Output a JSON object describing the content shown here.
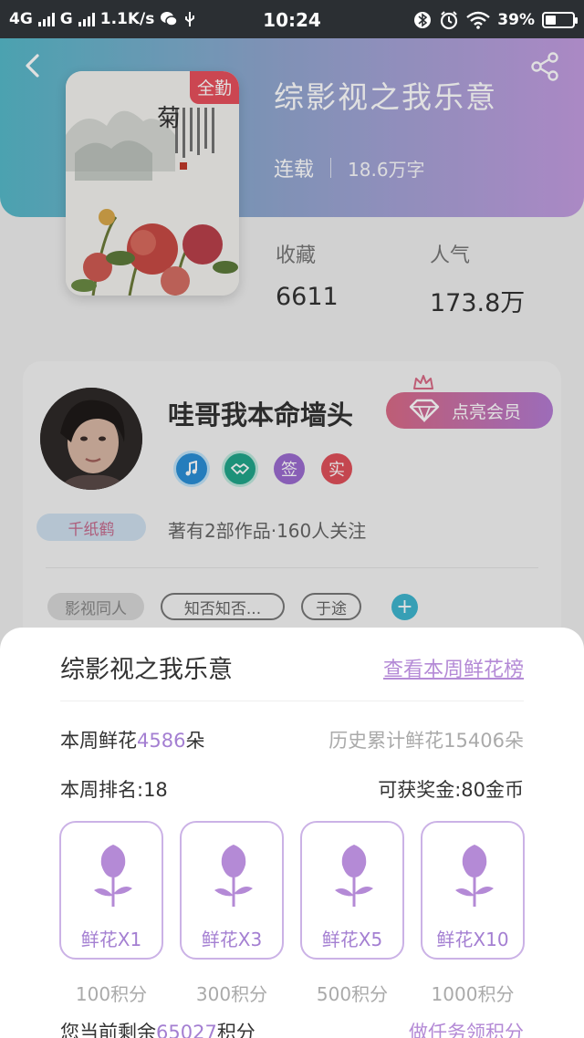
{
  "status_bar": {
    "network1": "4G",
    "network2": "G",
    "speed": "1.1K/s",
    "time": "10:24",
    "battery": "39%",
    "battery_level": 0.39
  },
  "book": {
    "badge": "全勤",
    "title": "综影视之我乐意",
    "status": "连载",
    "words": "18.6万字",
    "stats": [
      {
        "label": "收藏",
        "value": "6611"
      },
      {
        "label": "人气",
        "value": "173.8万"
      }
    ]
  },
  "author": {
    "name": "哇哥我本命墙头",
    "vip_button": "点亮会员",
    "medals": [
      "签",
      "实"
    ],
    "crane_badge": "千纸鹤",
    "works": "著有2部作品·160人关注",
    "tags": [
      "影视同人",
      "知否知否...",
      "于途"
    ],
    "add_tag": "+"
  },
  "flower_sheet": {
    "title": "综影视之我乐意",
    "ranking_link": "查看本周鲜花榜",
    "week_flowers_prefix": "本周鲜花",
    "week_flowers_count": "4586",
    "week_flowers_suffix": "朵",
    "history_flowers": "历史累计鲜花15406朵",
    "week_rank": "本周排名:18",
    "reward": "可获奖金:80金币",
    "options": [
      {
        "label": "鲜花X1",
        "cost": "100积分"
      },
      {
        "label": "鲜花X3",
        "cost": "300积分"
      },
      {
        "label": "鲜花X5",
        "cost": "500积分"
      },
      {
        "label": "鲜花X10",
        "cost": "1000积分"
      }
    ],
    "remaining_prefix": "您当前剩余",
    "remaining_points": "65027",
    "remaining_suffix": "积分",
    "task_link": "做任务领积分"
  },
  "colors": {
    "accent": "#a47fd2",
    "header_start": "#56b9c9",
    "header_end": "#c39ce0",
    "badge_red": "#e7505d"
  }
}
